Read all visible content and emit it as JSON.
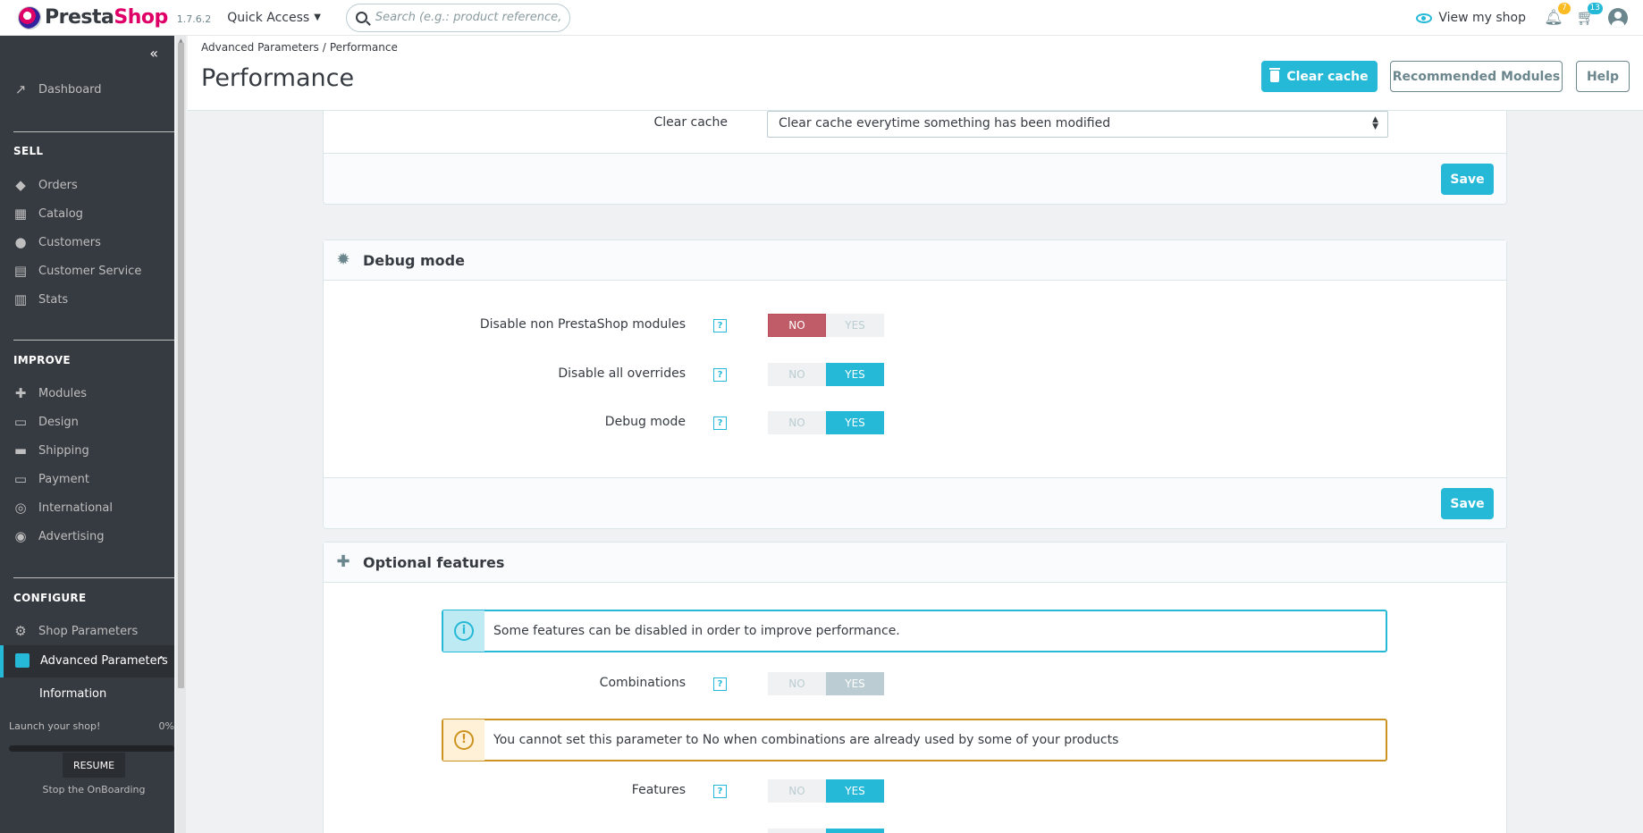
{
  "header": {
    "logo_part1": "Presta",
    "logo_part2": "Shop",
    "version": "1.7.6.2",
    "quick_access": "Quick Access",
    "search_placeholder": "Search (e.g.: product reference, custome",
    "view_shop": "View my shop",
    "notifications_count": "7",
    "orders_count": "13"
  },
  "sidebar": {
    "dashboard": "Dashboard",
    "sections": [
      {
        "title": "SELL",
        "items": [
          "Orders",
          "Catalog",
          "Customers",
          "Customer Service",
          "Stats"
        ]
      },
      {
        "title": "IMPROVE",
        "items": [
          "Modules",
          "Design",
          "Shipping",
          "Payment",
          "International",
          "Advertising"
        ]
      },
      {
        "title": "CONFIGURE",
        "items": [
          "Shop Parameters",
          "Advanced Parameters"
        ]
      }
    ],
    "active_item": "Advanced Parameters",
    "sub_item": "Information",
    "onboarding": {
      "launch": "Launch your shop!",
      "percent": "0%",
      "resume": "RESUME",
      "stop": "Stop the OnBoarding"
    }
  },
  "page": {
    "breadcrumb": [
      "Advanced Parameters",
      "Performance"
    ],
    "title": "Performance",
    "buttons": {
      "clear_cache": "Clear cache",
      "recommended": "Recommended Modules",
      "help": "Help"
    }
  },
  "cache_card": {
    "label": "Clear cache",
    "selected": "Clear cache everytime something has been modified",
    "save": "Save"
  },
  "debug_card": {
    "title": "Debug mode",
    "rows": [
      {
        "label": "Disable non PrestaShop modules",
        "value": "NO"
      },
      {
        "label": "Disable all overrides",
        "value": "YES"
      },
      {
        "label": "Debug mode",
        "value": "YES"
      }
    ],
    "save": "Save"
  },
  "optional_card": {
    "title": "Optional features",
    "info": "Some features can be disabled in order to improve performance.",
    "warning": "You cannot set this parameter to No when combinations are already used by some of your products",
    "rows": [
      {
        "label": "Combinations",
        "value": "YES",
        "disabled": true
      },
      {
        "label": "Features",
        "value": "YES",
        "disabled": false
      }
    ]
  },
  "switch_labels": {
    "no": "NO",
    "yes": "YES"
  },
  "help_glyph": "?",
  "colors": {
    "accent": "#25b9d7",
    "danger": "#c05c67",
    "brand": "#df0067",
    "sidebar": "#363a41"
  }
}
